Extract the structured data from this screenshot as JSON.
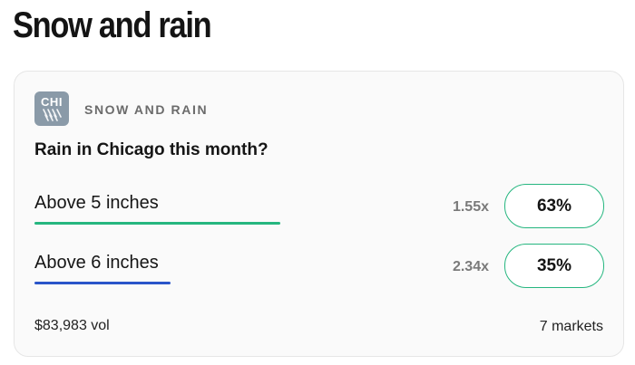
{
  "page": {
    "title": "Snow and rain"
  },
  "market": {
    "icon_text": "CHI",
    "icon_color": "#8a9aa8",
    "category": "SNOW AND RAIN",
    "question": "Rain in Chicago this month?",
    "outcomes": [
      {
        "label": "Above 5 inches",
        "payout": "1.55x",
        "probability": "63%",
        "bar_color": "#25b67f"
      },
      {
        "label": "Above 6 inches",
        "payout": "2.34x",
        "probability": "35%",
        "bar_color": "#2a55c9"
      }
    ],
    "volume": "$83,983 vol",
    "markets_count": "7 markets"
  },
  "colors": {
    "accent_green": "#25b67f",
    "accent_blue": "#2a55c9"
  }
}
